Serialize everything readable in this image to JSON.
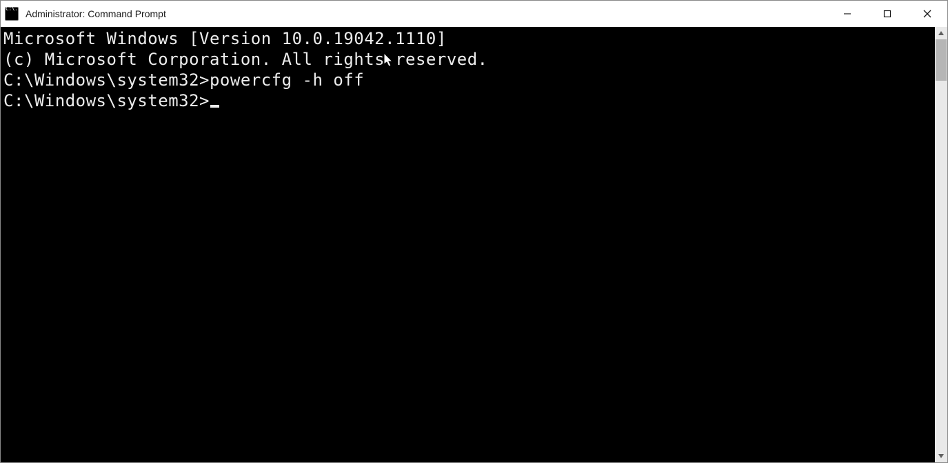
{
  "window": {
    "title": "Administrator: Command Prompt",
    "icon_label": "C:\\."
  },
  "terminal": {
    "lines": [
      "Microsoft Windows [Version 10.0.19042.1110]",
      "(c) Microsoft Corporation. All rights reserved.",
      "",
      "C:\\Windows\\system32>powercfg -h off",
      "",
      "C:\\Windows\\system32>"
    ],
    "cursor_on_last": true
  }
}
